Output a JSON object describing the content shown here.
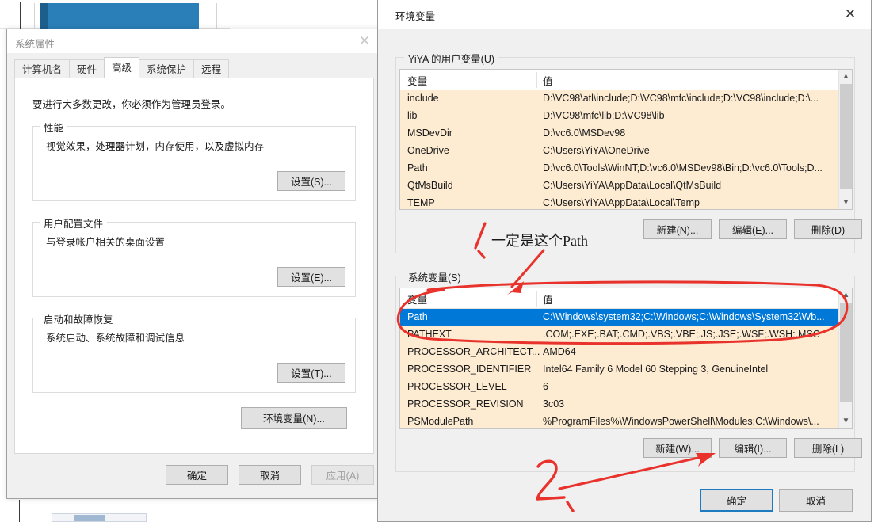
{
  "background": {
    "taskbar_label": ""
  },
  "system_properties": {
    "title": "系统属性",
    "close_icon": "close-icon",
    "tabs": [
      {
        "label": "计算机名",
        "active": false
      },
      {
        "label": "硬件",
        "active": false
      },
      {
        "label": "高级",
        "active": true
      },
      {
        "label": "系统保护",
        "active": false
      },
      {
        "label": "远程",
        "active": false
      }
    ],
    "intro": "要进行大多数更改，你必须作为管理员登录。",
    "groups": [
      {
        "title": "性能",
        "desc": "视觉效果，处理器计划，内存使用，以及虚拟内存",
        "button": "设置(S)..."
      },
      {
        "title": "用户配置文件",
        "desc": "与登录帐户相关的桌面设置",
        "button": "设置(E)..."
      },
      {
        "title": "启动和故障恢复",
        "desc": "系统启动、系统故障和调试信息",
        "button": "设置(T)..."
      }
    ],
    "env_button": "环境变量(N)...",
    "footer": {
      "ok": "确定",
      "cancel": "取消",
      "apply": "应用(A)",
      "apply_disabled": true
    }
  },
  "env_dialog": {
    "title": "环境变量",
    "close_icon": "close-icon",
    "user_section": {
      "title": "YiYA 的用户变量(U)",
      "columns": [
        "变量",
        "值"
      ],
      "rows": [
        {
          "name": "include",
          "value": "D:\\VC98\\atl\\include;D:\\VC98\\mfc\\include;D:\\VC98\\include;D:\\..."
        },
        {
          "name": "lib",
          "value": "D:\\VC98\\mfc\\lib;D:\\VC98\\lib"
        },
        {
          "name": "MSDevDir",
          "value": "D:\\vc6.0\\MSDev98"
        },
        {
          "name": "OneDrive",
          "value": "C:\\Users\\YiYA\\OneDrive"
        },
        {
          "name": "Path",
          "value": "D:\\vc6.0\\Tools\\WinNT;D:\\vc6.0\\MSDev98\\Bin;D:\\vc6.0\\Tools;D..."
        },
        {
          "name": "QtMsBuild",
          "value": "C:\\Users\\YiYA\\AppData\\Local\\QtMsBuild"
        },
        {
          "name": "TEMP",
          "value": "C:\\Users\\YiYA\\AppData\\Local\\Temp"
        }
      ],
      "buttons": {
        "new": "新建(N)...",
        "edit": "编辑(E)...",
        "delete": "删除(D)"
      }
    },
    "system_section": {
      "title": "系统变量(S)",
      "columns": [
        "变量",
        "值"
      ],
      "rows": [
        {
          "name": "Path",
          "value": "C:\\Windows\\system32;C:\\Windows;C:\\Windows\\System32\\Wb...",
          "selected": true
        },
        {
          "name": "PATHEXT",
          "value": ".COM;.EXE;.BAT;.CMD;.VBS;.VBE;.JS;.JSE;.WSF;.WSH;.MSC",
          "selected": false
        },
        {
          "name": "PROCESSOR_ARCHITECT...",
          "value": "AMD64",
          "selected": false
        },
        {
          "name": "PROCESSOR_IDENTIFIER",
          "value": "Intel64 Family 6 Model 60 Stepping 3, GenuineIntel",
          "selected": false
        },
        {
          "name": "PROCESSOR_LEVEL",
          "value": "6",
          "selected": false
        },
        {
          "name": "PROCESSOR_REVISION",
          "value": "3c03",
          "selected": false
        },
        {
          "name": "PSModulePath",
          "value": "%ProgramFiles%\\WindowsPowerShell\\Modules;C:\\Windows\\...",
          "selected": false
        }
      ],
      "buttons": {
        "new": "新建(W)...",
        "edit": "编辑(I)...",
        "delete": "删除(L)"
      }
    },
    "footer": {
      "ok": "确定",
      "cancel": "取消"
    }
  },
  "annotations": {
    "note_1": "一定是这个Path",
    "mark_1": "1、",
    "mark_2": "2、",
    "color": "#e8322b"
  },
  "colors": {
    "selection_blue": "#0078d7",
    "row_background": "#fdebd2",
    "dialog_background": "#f0f0f0",
    "annotation_red": "#e8322b",
    "taskbar_blue": "#2a7fb8"
  }
}
